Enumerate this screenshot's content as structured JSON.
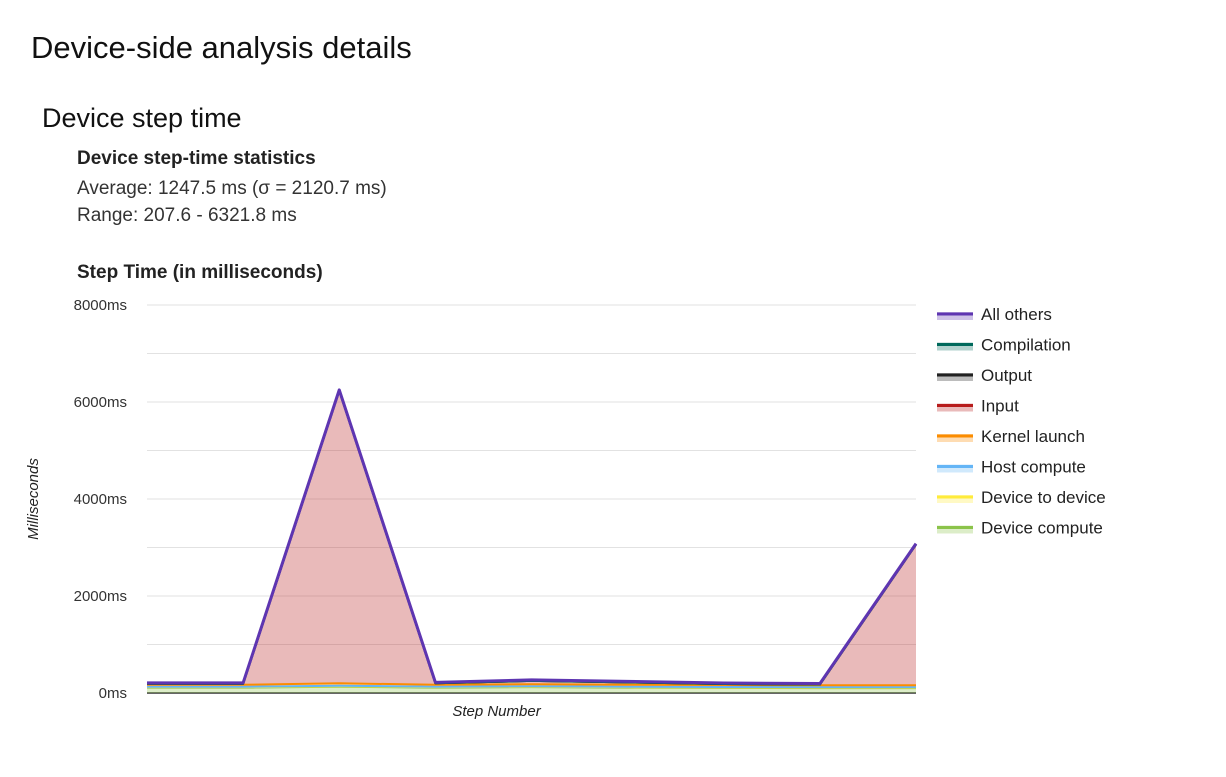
{
  "page": {
    "title": "Device-side analysis details"
  },
  "section": {
    "title": "Device step time",
    "stats_heading": "Device step-time statistics",
    "average_text": "Average: 1247.5 ms (σ = 2120.7 ms)",
    "range_text": "Range: 207.6 - 6321.8 ms"
  },
  "chart_title": "Step Time (in milliseconds)",
  "chart_data": {
    "type": "area",
    "stacked": true,
    "title": "Step Time (in milliseconds)",
    "xlabel": "Step Number",
    "ylabel": "Milliseconds",
    "ylim": [
      0,
      8000
    ],
    "y_ticks": [
      0,
      2000,
      4000,
      6000,
      8000
    ],
    "y_tick_labels": [
      "0ms",
      "2000ms",
      "4000ms",
      "6000ms",
      "8000ms"
    ],
    "grid": true,
    "legend_position": "right",
    "x": [
      0,
      1,
      2,
      3,
      4,
      5,
      6,
      7,
      8
    ],
    "series": [
      {
        "name": "Device compute",
        "color": "#8bc34a",
        "values": [
          110,
          110,
          130,
          110,
          120,
          110,
          105,
          100,
          100
        ]
      },
      {
        "name": "Device to device",
        "color": "#ffeb3b",
        "values": [
          10,
          10,
          10,
          10,
          10,
          10,
          10,
          10,
          10
        ]
      },
      {
        "name": "Host compute",
        "color": "#64b5f6",
        "values": [
          10,
          10,
          10,
          10,
          10,
          10,
          10,
          10,
          10
        ]
      },
      {
        "name": "Kernel launch",
        "color": "#fb8c00",
        "values": [
          40,
          40,
          50,
          40,
          40,
          40,
          40,
          40,
          40
        ]
      },
      {
        "name": "Input",
        "color": "#b71c1c",
        "values": [
          20,
          20,
          6030,
          30,
          70,
          50,
          20,
          15,
          2900
        ]
      },
      {
        "name": "Output",
        "color": "#212121",
        "values": [
          0,
          0,
          0,
          0,
          0,
          0,
          0,
          0,
          0
        ]
      },
      {
        "name": "Compilation",
        "color": "#00695c",
        "values": [
          0,
          0,
          0,
          0,
          0,
          0,
          0,
          0,
          0
        ]
      },
      {
        "name": "All others",
        "color": "#5e35b1",
        "values": [
          20,
          20,
          20,
          20,
          20,
          20,
          20,
          20,
          20
        ]
      }
    ],
    "legend_order": [
      "All others",
      "Compilation",
      "Output",
      "Input",
      "Kernel launch",
      "Host compute",
      "Device to device",
      "Device compute"
    ]
  }
}
